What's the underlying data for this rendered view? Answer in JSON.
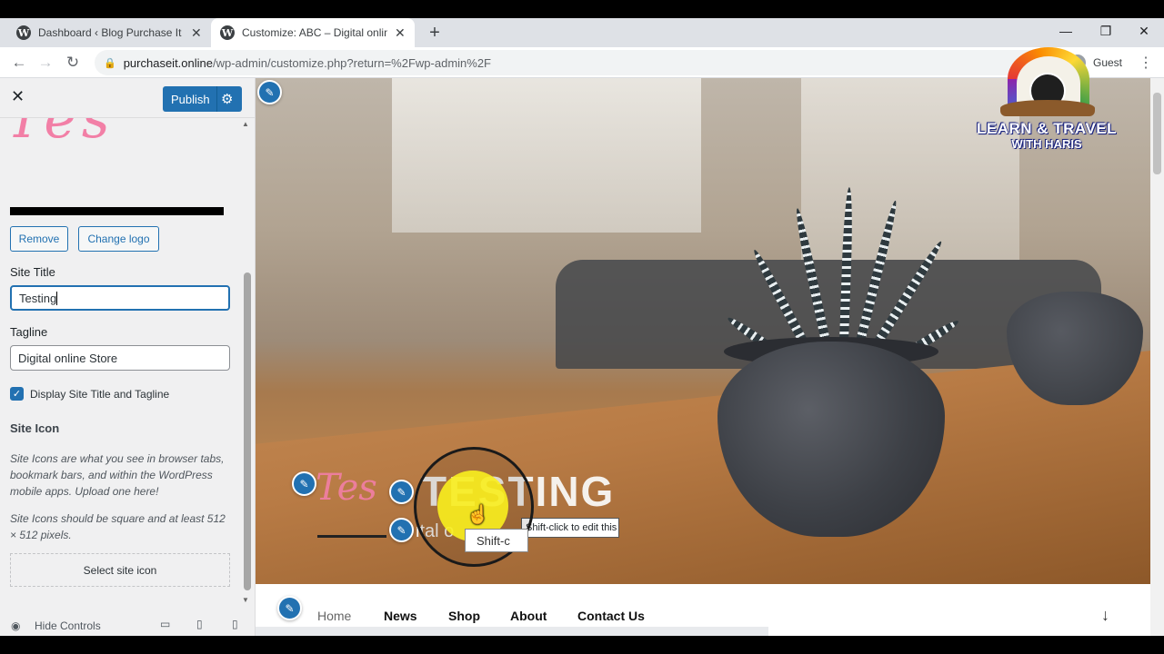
{
  "browser": {
    "tabs": [
      {
        "title": "Dashboard ‹ Blog Purchase It On",
        "close": "✕"
      },
      {
        "title": "Customize: ABC – Digital online S",
        "close": "✕"
      }
    ],
    "new_tab": "+",
    "window_controls": {
      "minimize": "—",
      "restore": "❐",
      "close": "✕"
    },
    "back": "←",
    "forward": "→",
    "reload": "↻",
    "url_host": "purchaseit.online",
    "url_path": "/wp-admin/customize.php?return=%2Fwp-admin%2F",
    "profile_label": "Guest",
    "menu_icon": "⋮"
  },
  "customizer": {
    "close_icon": "✕",
    "publish_label": "Publish",
    "gear_icon": "⚙",
    "logo_script_text": "Tes",
    "remove_label": "Remove",
    "change_logo_label": "Change logo",
    "site_title_label": "Site Title",
    "site_title_value": "Testing",
    "tagline_label": "Tagline",
    "tagline_value": "Digital online Store",
    "display_checkbox_label": "Display Site Title and Tagline",
    "display_checked": true,
    "site_icon_heading": "Site Icon",
    "site_icon_desc1": "Site Icons are what you see in browser tabs, bookmark bars, and within the WordPress mobile apps. Upload one here!",
    "site_icon_desc2": "Site Icons should be square and at least 512 × 512 pixels.",
    "select_icon_label": "Select site icon",
    "hide_controls_label": "Hide Controls"
  },
  "preview": {
    "logo_script": "Tes",
    "site_title": "TESTING",
    "tagline": "ital o",
    "tooltip_text": "Shift-click to edit this element.",
    "tooltip2_text": "Shift-c",
    "edit_icon": "✎",
    "hand_cursor": "☝",
    "nav": [
      "Home",
      "News",
      "Shop",
      "About",
      "Contact Us"
    ],
    "down_arrow": "↓"
  },
  "watermark": {
    "line1": "LEARN & TRAVEL",
    "line2": "WITH HARIS"
  },
  "colors": {
    "wp_blue": "#2271b1",
    "logo_pink": "#f27fa6",
    "sidebar_bg": "#f0f0f1"
  }
}
